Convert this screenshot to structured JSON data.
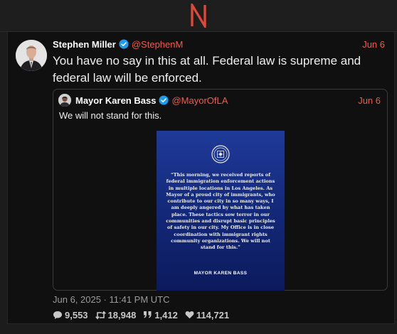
{
  "brand": {
    "logo_letter": "N",
    "accent": "#e0483a"
  },
  "post": {
    "author_name": "Stephen Miller",
    "author_handle": "@StephenM",
    "date": "Jun 6",
    "text": "You have no say in this at all. Federal law is supreme and federal law will be enforced.",
    "timestamp": "Jun 6, 2025 · 11:41 PM UTC",
    "stats": {
      "replies": "9,553",
      "retweets": "18,948",
      "quotes": "1,412",
      "likes": "114,721"
    }
  },
  "quote": {
    "author_name": "Mayor Karen Bass",
    "author_handle": "@MayorOfLA",
    "date": "Jun 6",
    "text": "We will not stand for this.",
    "image": {
      "body": "“This morning, we received reports of federal immigration enforcement actions in multiple locations in Los Angeles. As Mayor of a proud city of immigrants, who contribute to our city in so many ways, I am deeply angered by what has taken place. These tactics sow terror in our communities and disrupt basic principles of safety in our city. My Office is in close coordination with immigrant rights community organizations. We will not stand for this.”",
      "signature": "MAYOR KAREN BASS"
    }
  },
  "icons": {
    "verified": "verified-badge-icon",
    "replies": "comment-icon",
    "retweets": "retweet-icon",
    "quotes": "quote-icon",
    "likes": "heart-icon"
  },
  "colors": {
    "background": "#101010",
    "handle": "#ef5b4c",
    "verified": "#1d9bf0"
  }
}
